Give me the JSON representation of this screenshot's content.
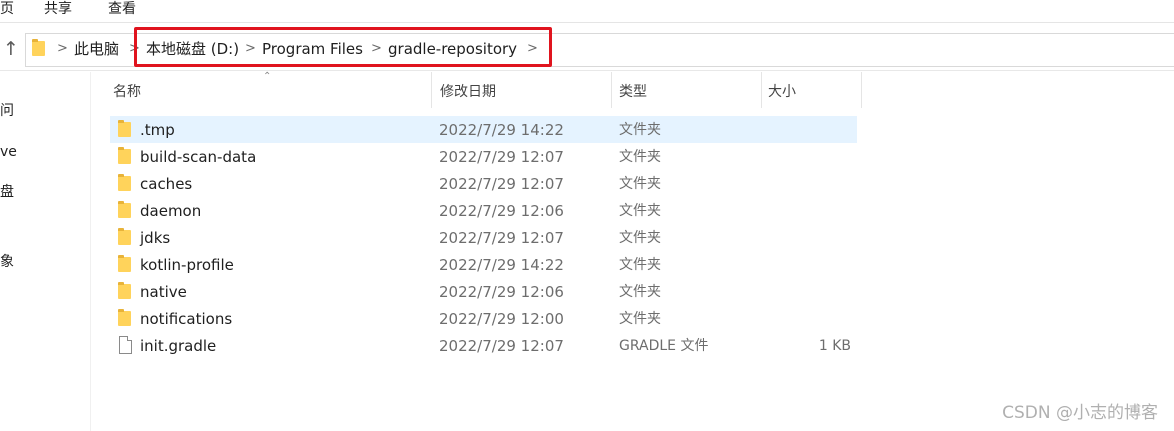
{
  "ribbon": {
    "tabs": [
      "页",
      "共享",
      "查看"
    ]
  },
  "address_bar": {
    "crumbs": [
      "此电脑",
      "本地磁盘 (D:)",
      "Program Files",
      "gradle-repository"
    ],
    "separator": ">"
  },
  "nav_pane": {
    "fragments": [
      "问",
      "ve",
      "盘",
      "象"
    ]
  },
  "columns": {
    "name": "名称",
    "date": "修改日期",
    "type": "类型",
    "size": "大小"
  },
  "files": [
    {
      "name": ".tmp",
      "date": "2022/7/29 14:22",
      "type": "文件夹",
      "size": "",
      "kind": "folder",
      "selected": true
    },
    {
      "name": "build-scan-data",
      "date": "2022/7/29 12:07",
      "type": "文件夹",
      "size": "",
      "kind": "folder"
    },
    {
      "name": "caches",
      "date": "2022/7/29 12:07",
      "type": "文件夹",
      "size": "",
      "kind": "folder"
    },
    {
      "name": "daemon",
      "date": "2022/7/29 12:06",
      "type": "文件夹",
      "size": "",
      "kind": "folder"
    },
    {
      "name": "jdks",
      "date": "2022/7/29 12:07",
      "type": "文件夹",
      "size": "",
      "kind": "folder"
    },
    {
      "name": "kotlin-profile",
      "date": "2022/7/29 14:22",
      "type": "文件夹",
      "size": "",
      "kind": "folder"
    },
    {
      "name": "native",
      "date": "2022/7/29 12:06",
      "type": "文件夹",
      "size": "",
      "kind": "folder"
    },
    {
      "name": "notifications",
      "date": "2022/7/29 12:00",
      "type": "文件夹",
      "size": "",
      "kind": "folder"
    },
    {
      "name": "init.gradle",
      "date": "2022/7/29 12:07",
      "type": "GRADLE 文件",
      "size": "1 KB",
      "kind": "file"
    }
  ],
  "watermark": "CSDN @小志的博客",
  "colors": {
    "highlight_border": "#e0141e",
    "selection": "#e5f3ff",
    "folder": "#ffd35b"
  }
}
